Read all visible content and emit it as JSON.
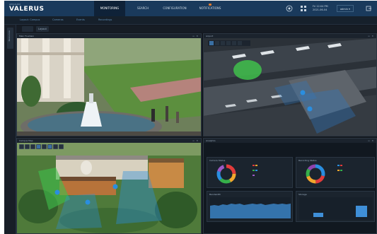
{
  "brand": {
    "sub": "AVIGILON",
    "name": "VALERUS"
  },
  "nav": {
    "tabs": [
      {
        "label": "MONITORING",
        "active": true
      },
      {
        "label": "SEARCH",
        "active": false
      },
      {
        "label": "CONFIGURATION",
        "active": false
      },
      {
        "label": "NOTIFICATIONS",
        "active": false
      }
    ],
    "time_top": "Fri 12:04 PM",
    "time_bottom": "2021-06-04",
    "user_label": "admin"
  },
  "subbar": {
    "items": [
      "Layout: Campus",
      "Cameras",
      "Events",
      "Recordings"
    ]
  },
  "rail": {
    "label": "Resources"
  },
  "toolbar": {
    "buttons": [
      "",
      "Layout"
    ]
  },
  "panels": {
    "top_left_title": "Main Fountain",
    "top_right_title": "Airport",
    "bottom_left_title": "Campus Map",
    "bottom_right_title": "Analytics"
  },
  "dashboard": {
    "cards": [
      {
        "title": "Camera Status"
      },
      {
        "title": "Recording Status"
      },
      {
        "title": "Bandwidth"
      },
      {
        "title": "Storage"
      }
    ]
  },
  "colors": {
    "accent": "#1a3a5c",
    "donut_1": [
      "#e23b3b",
      "#f2a72d",
      "#36b04a",
      "#2a8ee0",
      "#9b59c6",
      "#e8d23a"
    ],
    "donut_2": [
      "#2a8ee0",
      "#e23b3b",
      "#f2a72d",
      "#36b04a",
      "#8e44ad"
    ],
    "chart_fill": "#3f8fd8"
  }
}
